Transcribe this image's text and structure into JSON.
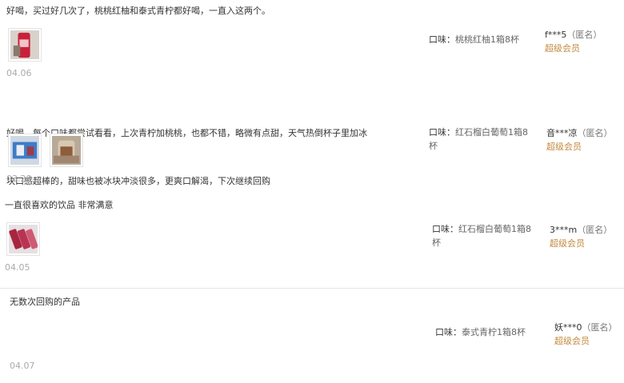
{
  "reviews": [
    {
      "text": "好喝，买过好几次了，桃桃红柚和泰式青柠都好喝，一直入这两个。",
      "date": "04.06",
      "spec_label": "口味：",
      "spec_value": "桃桃红柚1箱8杯",
      "user": "f***5",
      "anon": "（匿名）",
      "level": "超级会员"
    },
    {
      "text_line1": "好喝，每个口味都尝试看看，上次青柠加桃桃，也都不错，略微有点甜，天气热倒杯子里加冰",
      "text_line2": "块口感超棒的，甜味也被冰块冲淡很多，更爽口解渴，下次继续回购",
      "date": "03.28",
      "spec_label": "口味：",
      "spec_value_line1": "红石榴白葡萄1箱8",
      "spec_value_line2": "杯",
      "user": "音***凉",
      "anon": "（匿名）",
      "level": "超级会员"
    },
    {
      "text": "一直很喜欢的饮品 非常满意",
      "date": "04.05",
      "spec_label": "口味：",
      "spec_value_line1": "红石榴白葡萄1箱8",
      "spec_value_line2": "杯",
      "user": "3***m",
      "anon": "（匿名）",
      "level": "超级会员"
    },
    {
      "text": "无数次回购的产品",
      "date": "04.07",
      "spec_label": "口味：",
      "spec_value": "泰式青柠1箱8杯",
      "user": "妖***0",
      "anon": "（匿名）",
      "level": "超级会员"
    }
  ],
  "colors": {
    "member_level": "#c28a3e",
    "date": "#aaaaaa",
    "divider": "#e6e6e6"
  }
}
